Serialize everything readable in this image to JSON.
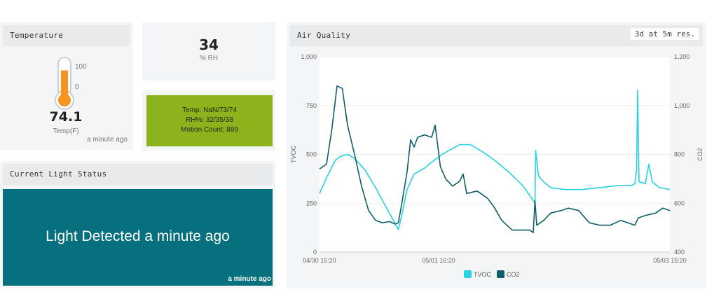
{
  "temperature": {
    "title": "Temperature",
    "scale_max": "100",
    "scale_min": "0",
    "value": "74.1",
    "unit": "Temp(F)",
    "updated": "a minute ago",
    "fill_fraction": 0.741,
    "fill_color": "#f7931e"
  },
  "humidity": {
    "value": "34",
    "unit": "% RH"
  },
  "summary": {
    "line1": "Temp: NaN/73/74",
    "line2": "RH%: 32/35/38",
    "line3": "Motion Count: 889",
    "bg_color": "#8cb31b"
  },
  "light": {
    "title": "Current Light Status",
    "message": "Light Detected a minute ago",
    "updated": "a minute ago",
    "bg_color": "#06707e"
  },
  "air_quality": {
    "title": "Air Quality",
    "range_button": "3d at 5m res."
  },
  "chart_data": {
    "type": "line",
    "title": "Air Quality",
    "x_ticks": [
      "04/30 15:20",
      "05/01 16:20",
      "05/03 15:20"
    ],
    "y_left": {
      "label": "TVOC",
      "range": [
        0,
        1000
      ],
      "ticks": [
        "0",
        "250",
        "500",
        "750",
        "1,000"
      ]
    },
    "y_right": {
      "label": "CO2",
      "range": [
        400,
        1200
      ],
      "ticks": [
        "400",
        "600",
        "800",
        "1,000",
        "1,200"
      ]
    },
    "legend_position": "bottom",
    "series": [
      {
        "name": "TVOC",
        "axis": "left",
        "color": "#26d3e6",
        "points": [
          [
            0,
            300
          ],
          [
            0.02,
            380
          ],
          [
            0.045,
            470
          ],
          [
            0.06,
            490
          ],
          [
            0.08,
            500
          ],
          [
            0.1,
            480
          ],
          [
            0.13,
            420
          ],
          [
            0.16,
            330
          ],
          [
            0.19,
            230
          ],
          [
            0.215,
            150
          ],
          [
            0.225,
            115
          ],
          [
            0.235,
            190
          ],
          [
            0.25,
            320
          ],
          [
            0.27,
            400
          ],
          [
            0.3,
            430
          ],
          [
            0.32,
            460
          ],
          [
            0.35,
            500
          ],
          [
            0.38,
            530
          ],
          [
            0.4,
            550
          ],
          [
            0.43,
            550
          ],
          [
            0.46,
            520
          ],
          [
            0.5,
            470
          ],
          [
            0.54,
            410
          ],
          [
            0.58,
            340
          ],
          [
            0.6,
            290
          ],
          [
            0.615,
            250
          ],
          [
            0.617,
            520
          ],
          [
            0.625,
            390
          ],
          [
            0.64,
            360
          ],
          [
            0.66,
            330
          ],
          [
            0.7,
            320
          ],
          [
            0.75,
            320
          ],
          [
            0.8,
            330
          ],
          [
            0.85,
            340
          ],
          [
            0.88,
            340
          ],
          [
            0.89,
            340
          ],
          [
            0.9,
            350
          ],
          [
            0.905,
            420
          ],
          [
            0.908,
            830
          ],
          [
            0.912,
            360
          ],
          [
            0.93,
            350
          ],
          [
            0.94,
            450
          ],
          [
            0.95,
            360
          ],
          [
            0.97,
            330
          ],
          [
            1,
            320
          ]
        ]
      },
      {
        "name": "CO2",
        "axis": "right",
        "color": "#0e5f6b",
        "points": [
          [
            0,
            740
          ],
          [
            0.02,
            760
          ],
          [
            0.035,
            900
          ],
          [
            0.05,
            1080
          ],
          [
            0.065,
            1070
          ],
          [
            0.08,
            920
          ],
          [
            0.1,
            800
          ],
          [
            0.12,
            670
          ],
          [
            0.14,
            570
          ],
          [
            0.16,
            530
          ],
          [
            0.18,
            520
          ],
          [
            0.2,
            525
          ],
          [
            0.215,
            515
          ],
          [
            0.225,
            520
          ],
          [
            0.235,
            600
          ],
          [
            0.25,
            730
          ],
          [
            0.26,
            860
          ],
          [
            0.27,
            830
          ],
          [
            0.28,
            870
          ],
          [
            0.3,
            880
          ],
          [
            0.32,
            870
          ],
          [
            0.33,
            920
          ],
          [
            0.345,
            750
          ],
          [
            0.36,
            700
          ],
          [
            0.38,
            670
          ],
          [
            0.4,
            690
          ],
          [
            0.41,
            720
          ],
          [
            0.42,
            640
          ],
          [
            0.45,
            650
          ],
          [
            0.48,
            620
          ],
          [
            0.5,
            580
          ],
          [
            0.52,
            530
          ],
          [
            0.55,
            490
          ],
          [
            0.58,
            490
          ],
          [
            0.6,
            490
          ],
          [
            0.61,
            480
          ],
          [
            0.615,
            610
          ],
          [
            0.62,
            510
          ],
          [
            0.64,
            530
          ],
          [
            0.66,
            560
          ],
          [
            0.69,
            570
          ],
          [
            0.71,
            580
          ],
          [
            0.74,
            570
          ],
          [
            0.77,
            520
          ],
          [
            0.8,
            510
          ],
          [
            0.83,
            510
          ],
          [
            0.86,
            530
          ],
          [
            0.88,
            520
          ],
          [
            0.9,
            510
          ],
          [
            0.91,
            540
          ],
          [
            0.93,
            550
          ],
          [
            0.96,
            560
          ],
          [
            0.98,
            580
          ],
          [
            1,
            570
          ]
        ]
      }
    ]
  }
}
